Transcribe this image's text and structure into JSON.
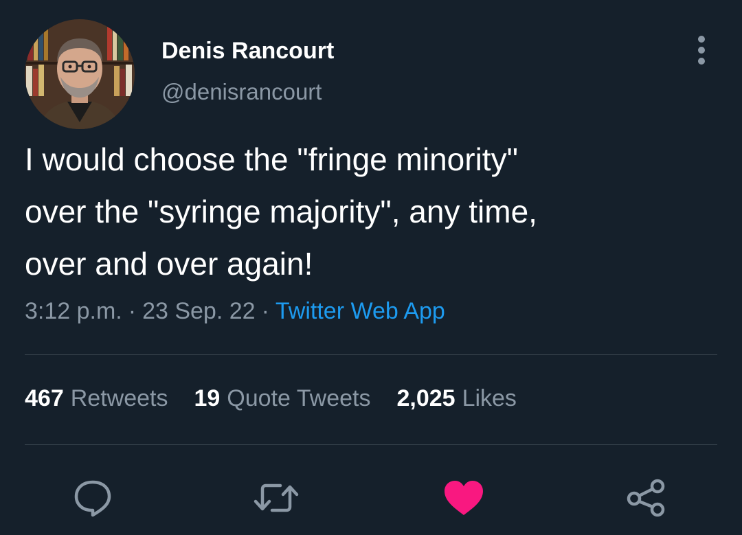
{
  "author": {
    "display_name": "Denis Rancourt",
    "handle": "@denisrancourt"
  },
  "tweet": {
    "text_lines": [
      "I would choose the \"fringe minority\"",
      "over the \"syringe majority\", any time,",
      "over and over again!"
    ],
    "time": "3:12 p.m.",
    "date": "23 Sep. 22",
    "separator": "·",
    "source": "Twitter Web App"
  },
  "stats": {
    "retweets_count": "467",
    "retweets_label": "Retweets",
    "quotes_count": "19",
    "quotes_label": "Quote Tweets",
    "likes_count": "2,025",
    "likes_label": "Likes"
  },
  "actions": {
    "reply_icon": "reply-icon",
    "retweet_icon": "retweet-icon",
    "like_icon": "heart-icon",
    "share_icon": "share-icon"
  },
  "colors": {
    "background": "#15202b",
    "secondary_text": "#8b98a5",
    "link": "#1d9bf0",
    "like_active": "#f91880",
    "divider": "#38444d"
  }
}
